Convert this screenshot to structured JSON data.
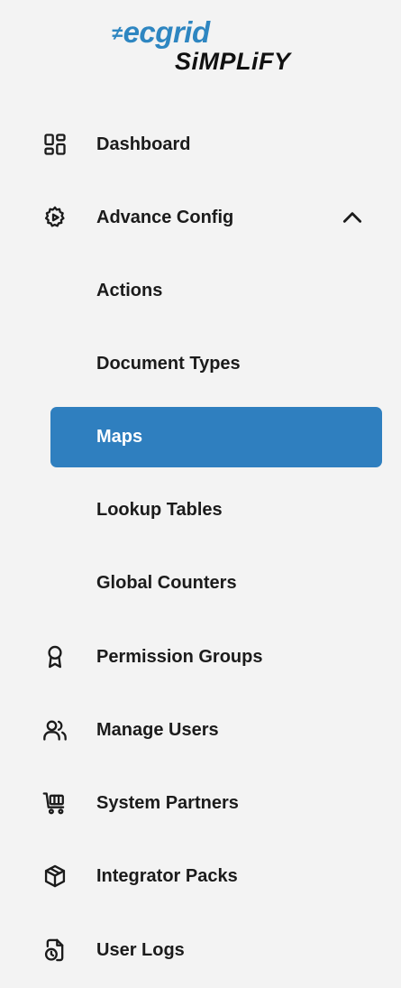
{
  "brand": {
    "logo_mark": "≠",
    "logo_top": "ecgrid",
    "logo_bottom": "SiMPLiFY"
  },
  "nav": {
    "dashboard": {
      "label": "Dashboard",
      "icon": "dashboard-grid-icon"
    },
    "advance_config": {
      "label": "Advance Config",
      "icon": "gear-icon",
      "expanded": true
    },
    "sub_items": {
      "actions": {
        "label": "Actions"
      },
      "document_types": {
        "label": "Document Types"
      },
      "maps": {
        "label": "Maps",
        "active": true
      },
      "lookup_tables": {
        "label": "Lookup Tables"
      },
      "global_counters": {
        "label": "Global Counters"
      }
    },
    "permission_groups": {
      "label": "Permission Groups",
      "icon": "award-ribbon-icon"
    },
    "manage_users": {
      "label": "Manage Users",
      "icon": "users-icon"
    },
    "system_partners": {
      "label": "System Partners",
      "icon": "cart-icon"
    },
    "integrator_packs": {
      "label": "Integrator Packs",
      "icon": "box-icon"
    },
    "user_logs": {
      "label": "User Logs",
      "icon": "log-file-icon"
    }
  },
  "colors": {
    "background": "#f3f3f3",
    "accent": "#2f7fbf",
    "logo_blue": "#2e86c1",
    "text": "#1b1b1b"
  }
}
